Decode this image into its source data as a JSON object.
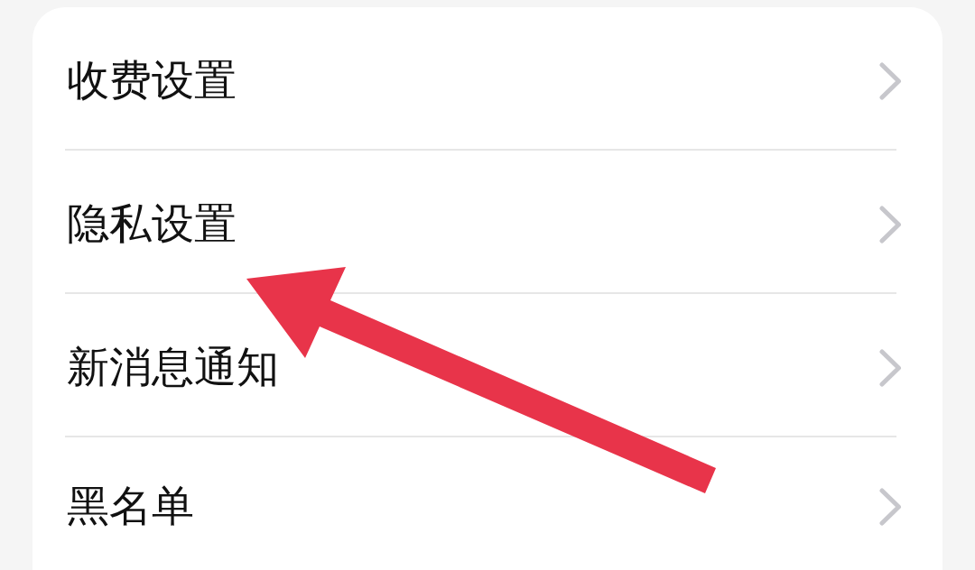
{
  "settings_list": {
    "items": [
      {
        "label": "收费设置"
      },
      {
        "label": "隐私设置"
      },
      {
        "label": "新消息通知"
      },
      {
        "label": "黑名单"
      }
    ]
  }
}
